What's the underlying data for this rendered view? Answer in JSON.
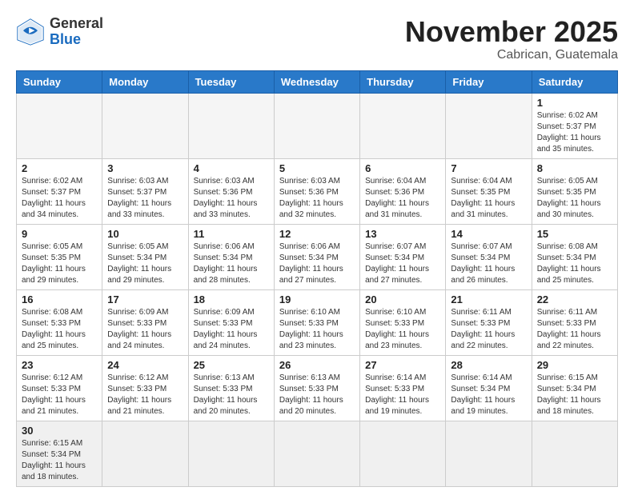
{
  "header": {
    "logo_general": "General",
    "logo_blue": "Blue",
    "month_title": "November 2025",
    "location": "Cabrican, Guatemala"
  },
  "weekdays": [
    "Sunday",
    "Monday",
    "Tuesday",
    "Wednesday",
    "Thursday",
    "Friday",
    "Saturday"
  ],
  "weeks": [
    [
      {
        "day": "",
        "info": ""
      },
      {
        "day": "",
        "info": ""
      },
      {
        "day": "",
        "info": ""
      },
      {
        "day": "",
        "info": ""
      },
      {
        "day": "",
        "info": ""
      },
      {
        "day": "",
        "info": ""
      },
      {
        "day": "1",
        "info": "Sunrise: 6:02 AM\nSunset: 5:37 PM\nDaylight: 11 hours\nand 35 minutes."
      }
    ],
    [
      {
        "day": "2",
        "info": "Sunrise: 6:02 AM\nSunset: 5:37 PM\nDaylight: 11 hours\nand 34 minutes."
      },
      {
        "day": "3",
        "info": "Sunrise: 6:03 AM\nSunset: 5:37 PM\nDaylight: 11 hours\nand 33 minutes."
      },
      {
        "day": "4",
        "info": "Sunrise: 6:03 AM\nSunset: 5:36 PM\nDaylight: 11 hours\nand 33 minutes."
      },
      {
        "day": "5",
        "info": "Sunrise: 6:03 AM\nSunset: 5:36 PM\nDaylight: 11 hours\nand 32 minutes."
      },
      {
        "day": "6",
        "info": "Sunrise: 6:04 AM\nSunset: 5:36 PM\nDaylight: 11 hours\nand 31 minutes."
      },
      {
        "day": "7",
        "info": "Sunrise: 6:04 AM\nSunset: 5:35 PM\nDaylight: 11 hours\nand 31 minutes."
      },
      {
        "day": "8",
        "info": "Sunrise: 6:05 AM\nSunset: 5:35 PM\nDaylight: 11 hours\nand 30 minutes."
      }
    ],
    [
      {
        "day": "9",
        "info": "Sunrise: 6:05 AM\nSunset: 5:35 PM\nDaylight: 11 hours\nand 29 minutes."
      },
      {
        "day": "10",
        "info": "Sunrise: 6:05 AM\nSunset: 5:34 PM\nDaylight: 11 hours\nand 29 minutes."
      },
      {
        "day": "11",
        "info": "Sunrise: 6:06 AM\nSunset: 5:34 PM\nDaylight: 11 hours\nand 28 minutes."
      },
      {
        "day": "12",
        "info": "Sunrise: 6:06 AM\nSunset: 5:34 PM\nDaylight: 11 hours\nand 27 minutes."
      },
      {
        "day": "13",
        "info": "Sunrise: 6:07 AM\nSunset: 5:34 PM\nDaylight: 11 hours\nand 27 minutes."
      },
      {
        "day": "14",
        "info": "Sunrise: 6:07 AM\nSunset: 5:34 PM\nDaylight: 11 hours\nand 26 minutes."
      },
      {
        "day": "15",
        "info": "Sunrise: 6:08 AM\nSunset: 5:34 PM\nDaylight: 11 hours\nand 25 minutes."
      }
    ],
    [
      {
        "day": "16",
        "info": "Sunrise: 6:08 AM\nSunset: 5:33 PM\nDaylight: 11 hours\nand 25 minutes."
      },
      {
        "day": "17",
        "info": "Sunrise: 6:09 AM\nSunset: 5:33 PM\nDaylight: 11 hours\nand 24 minutes."
      },
      {
        "day": "18",
        "info": "Sunrise: 6:09 AM\nSunset: 5:33 PM\nDaylight: 11 hours\nand 24 minutes."
      },
      {
        "day": "19",
        "info": "Sunrise: 6:10 AM\nSunset: 5:33 PM\nDaylight: 11 hours\nand 23 minutes."
      },
      {
        "day": "20",
        "info": "Sunrise: 6:10 AM\nSunset: 5:33 PM\nDaylight: 11 hours\nand 23 minutes."
      },
      {
        "day": "21",
        "info": "Sunrise: 6:11 AM\nSunset: 5:33 PM\nDaylight: 11 hours\nand 22 minutes."
      },
      {
        "day": "22",
        "info": "Sunrise: 6:11 AM\nSunset: 5:33 PM\nDaylight: 11 hours\nand 22 minutes."
      }
    ],
    [
      {
        "day": "23",
        "info": "Sunrise: 6:12 AM\nSunset: 5:33 PM\nDaylight: 11 hours\nand 21 minutes."
      },
      {
        "day": "24",
        "info": "Sunrise: 6:12 AM\nSunset: 5:33 PM\nDaylight: 11 hours\nand 21 minutes."
      },
      {
        "day": "25",
        "info": "Sunrise: 6:13 AM\nSunset: 5:33 PM\nDaylight: 11 hours\nand 20 minutes."
      },
      {
        "day": "26",
        "info": "Sunrise: 6:13 AM\nSunset: 5:33 PM\nDaylight: 11 hours\nand 20 minutes."
      },
      {
        "day": "27",
        "info": "Sunrise: 6:14 AM\nSunset: 5:33 PM\nDaylight: 11 hours\nand 19 minutes."
      },
      {
        "day": "28",
        "info": "Sunrise: 6:14 AM\nSunset: 5:34 PM\nDaylight: 11 hours\nand 19 minutes."
      },
      {
        "day": "29",
        "info": "Sunrise: 6:15 AM\nSunset: 5:34 PM\nDaylight: 11 hours\nand 18 minutes."
      }
    ],
    [
      {
        "day": "30",
        "info": "Sunrise: 6:15 AM\nSunset: 5:34 PM\nDaylight: 11 hours\nand 18 minutes."
      },
      {
        "day": "",
        "info": ""
      },
      {
        "day": "",
        "info": ""
      },
      {
        "day": "",
        "info": ""
      },
      {
        "day": "",
        "info": ""
      },
      {
        "day": "",
        "info": ""
      },
      {
        "day": "",
        "info": ""
      }
    ]
  ]
}
